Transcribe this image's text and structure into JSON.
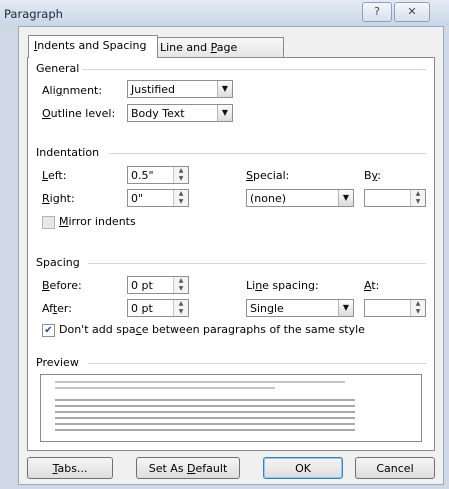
{
  "window": {
    "title": "Paragraph",
    "help_glyph": "?",
    "close_glyph": "✕"
  },
  "tabs": [
    {
      "label_pre": "",
      "accel": "I",
      "label_post": "ndents and Spacing",
      "active": true
    },
    {
      "label_pre": "Line and ",
      "accel": "P",
      "label_post": "age Breaks",
      "active": false
    }
  ],
  "general": {
    "heading": "General",
    "alignment": {
      "pre": "Ali",
      "accel": "g",
      "post": "nment:",
      "value": "Justified"
    },
    "outline": {
      "pre": "",
      "accel": "O",
      "post": "utline level:",
      "value": "Body Text"
    }
  },
  "indentation": {
    "heading": "Indentation",
    "left": {
      "pre": "",
      "accel": "L",
      "post": "eft:",
      "value": "0.5\""
    },
    "right": {
      "pre": "",
      "accel": "R",
      "post": "ight:",
      "value": "0\""
    },
    "special": {
      "pre": "",
      "accel": "S",
      "post": "pecial:",
      "value": "(none)"
    },
    "by": {
      "pre": "B",
      "accel": "y",
      "post": ":",
      "value": ""
    },
    "mirror": {
      "pre": "",
      "accel": "M",
      "post": "irror indents",
      "checked": false
    }
  },
  "spacing": {
    "heading": "Spacing",
    "before": {
      "pre": "",
      "accel": "B",
      "post": "efore:",
      "value": "0 pt"
    },
    "after": {
      "pre": "Af",
      "accel": "t",
      "post": "er:",
      "value": "0 pt"
    },
    "line_spacing": {
      "pre": "Li",
      "accel": "n",
      "post": "e spacing:",
      "value": "Single"
    },
    "at": {
      "pre": "",
      "accel": "A",
      "post": "t:",
      "value": ""
    },
    "dont_add": {
      "pre": "Don't add spa",
      "accel": "c",
      "post": "e between paragraphs of the same style",
      "checked": true
    }
  },
  "preview": {
    "heading": "Preview"
  },
  "buttons": {
    "tabs": {
      "pre": "",
      "accel": "T",
      "post": "abs..."
    },
    "set_default": {
      "pre": "Set As ",
      "accel": "D",
      "post": "efault"
    },
    "ok": "OK",
    "cancel": "Cancel"
  },
  "icons": {
    "dropdown": "▼",
    "spin_up": "▲",
    "spin_down": "▼",
    "check": "✔"
  }
}
